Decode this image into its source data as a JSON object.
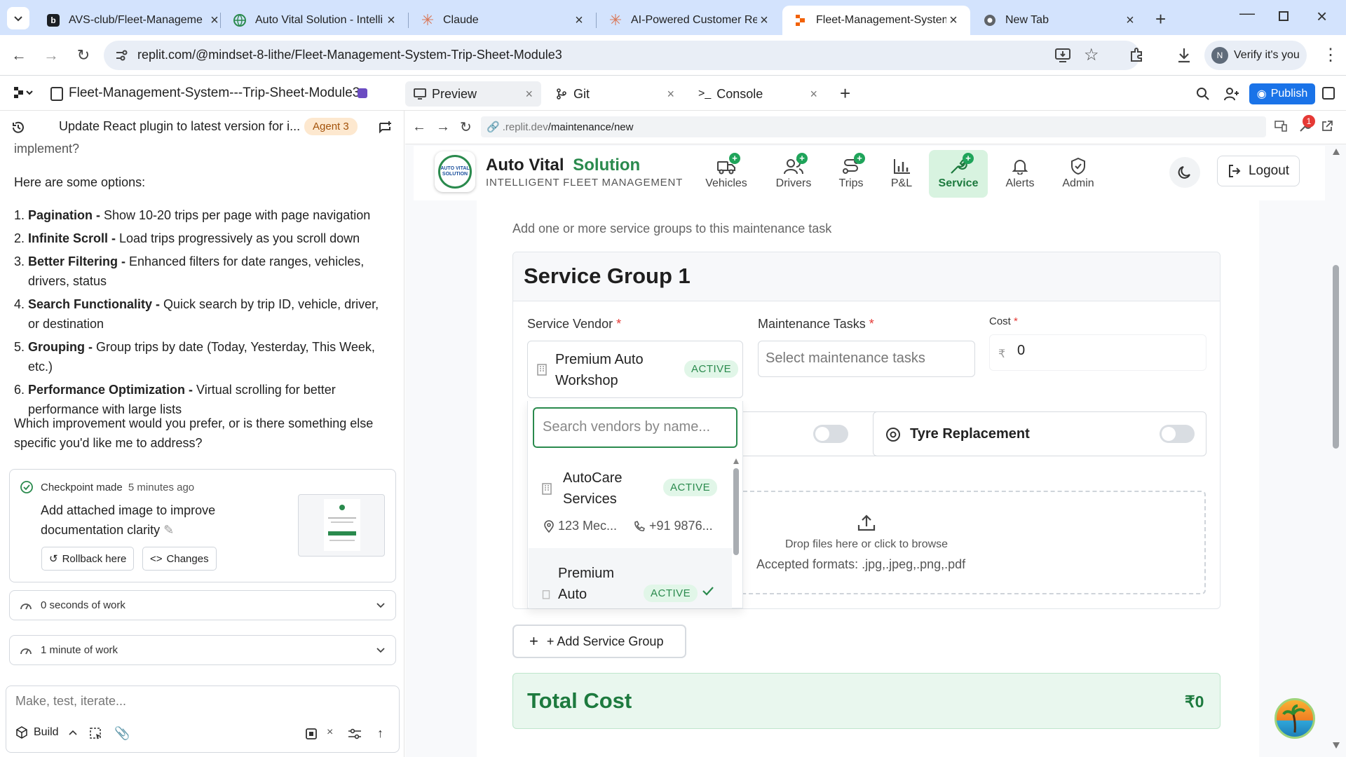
{
  "browser": {
    "tabs": [
      {
        "title": "AVS-club/Fleet-Manageme",
        "fav_color": "#1b1f24"
      },
      {
        "title": "Auto Vital Solution - Intelli",
        "fav_color": "#2a8a4d"
      },
      {
        "title": "Claude",
        "fav_color": "#d97757"
      },
      {
        "title": "AI-Powered Customer Rem",
        "fav_color": "#d97757"
      },
      {
        "title": "Fleet-Management-System",
        "fav_color": "#f26207"
      },
      {
        "title": "New Tab",
        "fav_color": "#5f6368"
      }
    ],
    "url": "replit.com/@mindset-8-lithe/Fleet-Management-System-Trip-Sheet-Module3",
    "profile_initial": "N",
    "profile_label": "Verify it's you"
  },
  "replit": {
    "project_name": "Fleet-Management-System---Trip-Sheet-Module3",
    "tabs": [
      {
        "label": "Preview"
      },
      {
        "label": "Git"
      },
      {
        "label": "Console"
      }
    ],
    "publish_label": "Publish",
    "thread_title": "Update React plugin to latest version for i...",
    "agent_badge": "Agent 3",
    "preview_url_prefix": ".replit.dev",
    "preview_url_path": "/maintenance/new",
    "notification_count": "1"
  },
  "chat": {
    "cut_line": "implement?",
    "intro": "Here are some options:",
    "options": [
      {
        "num": "1.",
        "title": "Pagination -",
        "text": " Show 10-20 trips per page with page navigation"
      },
      {
        "num": "2.",
        "title": "Infinite Scroll -",
        "text": " Load trips progressively as you scroll down"
      },
      {
        "num": "3.",
        "title": "Better Filtering -",
        "text": " Enhanced filters for date ranges, vehicles, drivers, status"
      },
      {
        "num": "4.",
        "title": "Search Functionality -",
        "text": " Quick search by trip ID, vehicle, driver, or destination"
      },
      {
        "num": "5.",
        "title": "Grouping -",
        "text": " Group trips by date (Today, Yesterday, This Week, etc.)"
      },
      {
        "num": "6.",
        "title": "Performance Optimization -",
        "text": " Virtual scrolling for better performance with large lists"
      }
    ],
    "question": "Which improvement would you prefer, or is there something else specific you'd like me to address?",
    "checkpoint": {
      "label": "Checkpoint made",
      "time": "5 minutes ago",
      "message": "Add attached image to improve documentation clarity",
      "rollback_label": "Rollback here",
      "changes_label": "Changes"
    },
    "work_items": [
      {
        "label": "0 seconds of work"
      },
      {
        "label": "1 minute of work"
      }
    ],
    "composer_placeholder": "Make, test, iterate...",
    "build_label": "Build"
  },
  "app": {
    "brand_name": "Auto Vital",
    "brand_accent": "Solution",
    "brand_tagline": "INTELLIGENT FLEET MANAGEMENT",
    "logo_text": "AUTO VITAL SOLUTION",
    "nav": [
      {
        "label": "Vehicles",
        "icon": "truck-icon"
      },
      {
        "label": "Drivers",
        "icon": "users-icon"
      },
      {
        "label": "Trips",
        "icon": "route-icon"
      },
      {
        "label": "P&L",
        "icon": "bar-chart-icon"
      },
      {
        "label": "Service",
        "icon": "wrench-icon",
        "active": true
      },
      {
        "label": "Alerts",
        "icon": "bell-icon"
      },
      {
        "label": "Admin",
        "icon": "shield-icon"
      }
    ],
    "logout_label": "Logout",
    "section_subtitle": "Add one or more service groups to this maintenance task",
    "group_title": "Service Group 1",
    "vendor_label": "Service Vendor",
    "tasks_label": "Maintenance Tasks",
    "cost_label": "Cost",
    "required_mark": "*",
    "selected_vendor": "Premium Auto Workshop",
    "active_badge": "ACTIVE",
    "tasks_placeholder": "Select maintenance tasks",
    "currency_symbol": "₹",
    "cost_value": "0",
    "vendor_search_placeholder": "Search vendors by name...",
    "vendor_options": [
      {
        "name": "AutoCare Services",
        "address": "123 Mec...",
        "phone": "+91 9876..."
      },
      {
        "name": "Premium Auto",
        "selected": true
      }
    ],
    "tyre_replacement_label": "Tyre Replacement",
    "upload_hint": "Drop files here or click to browse",
    "upload_formats": "Accepted formats: .jpg,.jpeg,.png,.pdf",
    "add_group_label": "+ Add Service Group",
    "total_label": "Total Cost",
    "total_value": "₹0",
    "accent_color": "#1d7a3e"
  }
}
